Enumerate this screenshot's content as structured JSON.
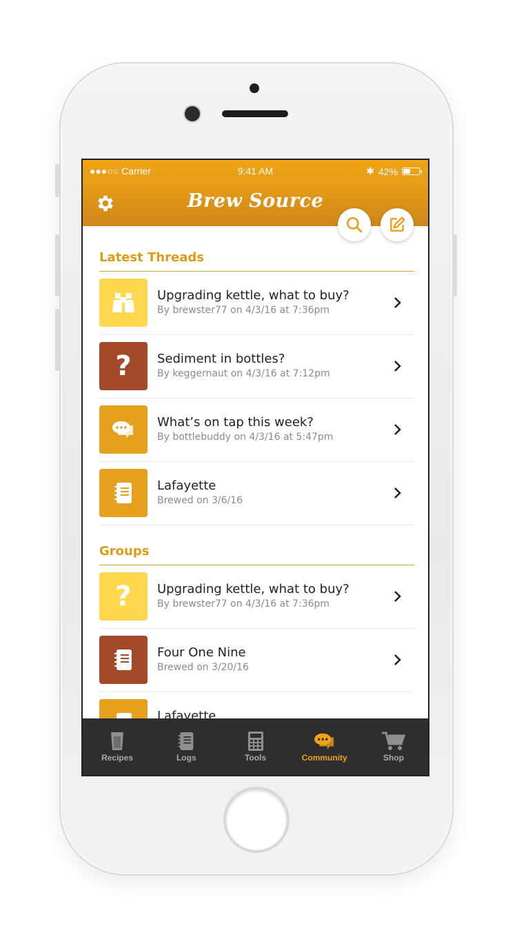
{
  "status_bar": {
    "carrier": "●●●○○ Carrier",
    "time": "9:41 AM",
    "battery": "42%"
  },
  "app": {
    "title": "Brew Source"
  },
  "sections": [
    {
      "title": "Latest Threads",
      "items": [
        {
          "title": "Upgrading kettle, what to buy?",
          "subtitle": "By brewster77 on 4/3/16 at 7:36pm",
          "icon": "binoculars-icon",
          "color": "#ffd84f"
        },
        {
          "title": "Sediment in bottles?",
          "subtitle": "By keggernaut on 4/3/16 at 7:12pm",
          "icon": "question-icon",
          "color": "#a24a2a"
        },
        {
          "title": "What’s on tap this week?",
          "subtitle": "By bottlebuddy on 4/3/16 at 5:47pm",
          "icon": "chat-icon",
          "color": "#e5a01d"
        },
        {
          "title": "Lafayette",
          "subtitle": "Brewed on 3/6/16",
          "icon": "notebook-icon",
          "color": "#e5a01d"
        }
      ]
    },
    {
      "title": "Groups",
      "items": [
        {
          "title": "Upgrading kettle, what to buy?",
          "subtitle": "By brewster77 on 4/3/16 at 7:36pm",
          "icon": "question-icon",
          "color": "#ffd84f"
        },
        {
          "title": "Four One Nine",
          "subtitle": "Brewed on 3/20/16",
          "icon": "notebook-icon",
          "color": "#a24a2a"
        },
        {
          "title": "Lafayette",
          "subtitle": "",
          "icon": "notebook-icon",
          "color": "#e5a01d"
        }
      ]
    }
  ],
  "tabs": [
    {
      "label": "Recipes",
      "icon": "pint-glass-icon",
      "active": false
    },
    {
      "label": "Logs",
      "icon": "notebook-icon",
      "active": false
    },
    {
      "label": "Tools",
      "icon": "calculator-icon",
      "active": false
    },
    {
      "label": "Community",
      "icon": "chat-icon",
      "active": true
    },
    {
      "label": "Shop",
      "icon": "cart-icon",
      "active": false
    }
  ],
  "colors": {
    "accent": "#f0a516",
    "tab_bar": "#2e2e2e"
  }
}
